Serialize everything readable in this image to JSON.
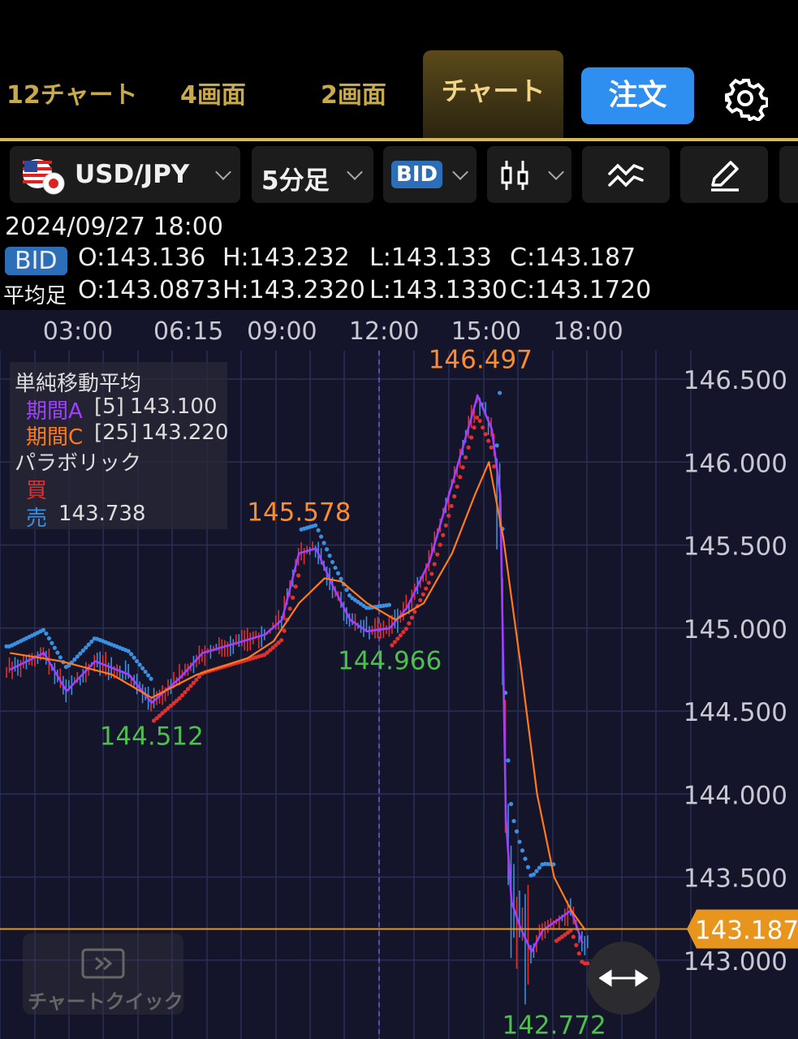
{
  "tabs": [
    {
      "label": "12チャート",
      "active": false
    },
    {
      "label": "4画面",
      "active": false
    },
    {
      "label": "2画面",
      "active": false
    },
    {
      "label": "チャート",
      "active": true
    }
  ],
  "order_button": "注文",
  "toolbar": {
    "pair": "USD/JPY",
    "timeframe": "5分足",
    "price_type": "BID"
  },
  "info": {
    "datetime": "2024/09/27 18:00",
    "bid_label": "BID",
    "bid_o": "O:143.136",
    "bid_h": "H:143.232",
    "bid_l": "L:143.133",
    "bid_c": "C:143.187",
    "ha_label": "平均足",
    "ha_o": "O:143.0873",
    "ha_h": "H:143.2320",
    "ha_l": "L:143.1330",
    "ha_c": "C:143.1720"
  },
  "legend": {
    "sma_title": "単純移動平均",
    "sma_a_label": "期間A",
    "sma_a_period": "[5]",
    "sma_a_value": "143.100",
    "sma_c_label": "期間C",
    "sma_c_period": "[25]",
    "sma_c_value": "143.220",
    "sar_title": "パラボリック",
    "sar_buy": "買",
    "sar_sell": "売",
    "sar_sell_value": "143.738"
  },
  "chart_quick_label": "チャートクイック",
  "chart_data": {
    "type": "line",
    "x_tick_labels": [
      "03:00",
      "06:15",
      "09:00",
      "12:00",
      "15:00",
      "18:00"
    ],
    "y_tick_labels": [
      "146.500",
      "146.000",
      "145.500",
      "145.000",
      "144.500",
      "144.000",
      "143.500",
      "143.000"
    ],
    "ylim": [
      142.7,
      146.75
    ],
    "current_price": "143.187",
    "annotations": [
      {
        "label": "146.497",
        "kind": "high",
        "time": "14:50"
      },
      {
        "label": "145.578",
        "kind": "high",
        "time": "09:30"
      },
      {
        "label": "144.966",
        "kind": "low",
        "time": "12:10"
      },
      {
        "label": "144.512",
        "kind": "low",
        "time": "05:10"
      },
      {
        "label": "142.772",
        "kind": "low",
        "time": "17:00"
      }
    ],
    "series": [
      {
        "name": "期間A",
        "color": "#a040ff",
        "points": [
          [
            "01:00",
            144.75
          ],
          [
            "02:00",
            144.85
          ],
          [
            "02:40",
            144.62
          ],
          [
            "03:30",
            144.8
          ],
          [
            "04:30",
            144.72
          ],
          [
            "05:10",
            144.55
          ],
          [
            "06:00",
            144.7
          ],
          [
            "06:40",
            144.85
          ],
          [
            "07:30",
            144.9
          ],
          [
            "08:30",
            144.96
          ],
          [
            "09:00",
            145.05
          ],
          [
            "09:30",
            145.45
          ],
          [
            "10:00",
            145.48
          ],
          [
            "10:30",
            145.25
          ],
          [
            "11:00",
            145.05
          ],
          [
            "11:30",
            144.98
          ],
          [
            "12:10",
            145.0
          ],
          [
            "12:40",
            145.12
          ],
          [
            "13:20",
            145.4
          ],
          [
            "13:50",
            145.75
          ],
          [
            "14:20",
            146.1
          ],
          [
            "14:45",
            146.4
          ],
          [
            "15:10",
            146.2
          ],
          [
            "15:25",
            145.8
          ],
          [
            "15:35",
            143.85
          ],
          [
            "15:45",
            143.35
          ],
          [
            "16:00",
            143.2
          ],
          [
            "16:20",
            143.05
          ],
          [
            "16:40",
            143.18
          ],
          [
            "17:10",
            143.25
          ],
          [
            "17:30",
            143.3
          ],
          [
            "17:50",
            143.1
          ]
        ]
      },
      {
        "name": "期間C",
        "color": "#ff7a1a",
        "points": [
          [
            "01:00",
            144.85
          ],
          [
            "02:30",
            144.8
          ],
          [
            "04:00",
            144.72
          ],
          [
            "05:10",
            144.58
          ],
          [
            "06:30",
            144.72
          ],
          [
            "08:00",
            144.82
          ],
          [
            "08:45",
            144.92
          ],
          [
            "09:30",
            145.15
          ],
          [
            "10:15",
            145.3
          ],
          [
            "10:45",
            145.28
          ],
          [
            "11:30",
            145.15
          ],
          [
            "12:20",
            145.05
          ],
          [
            "13:10",
            145.15
          ],
          [
            "14:00",
            145.45
          ],
          [
            "14:40",
            145.8
          ],
          [
            "15:05",
            146.0
          ],
          [
            "15:30",
            145.55
          ],
          [
            "16:00",
            144.8
          ],
          [
            "16:30",
            144.0
          ],
          [
            "17:00",
            143.5
          ],
          [
            "17:30",
            143.3
          ],
          [
            "17:55",
            143.18
          ]
        ]
      }
    ]
  },
  "colors": {
    "gold": "#d9b85c",
    "accent_blue": "#2f8ff0",
    "price_line": "#e8951e",
    "up_candle": "#e03030",
    "down_candle": "#3b8fe0",
    "label_high": "#ff8c2a",
    "label_low": "#4cc04c"
  }
}
